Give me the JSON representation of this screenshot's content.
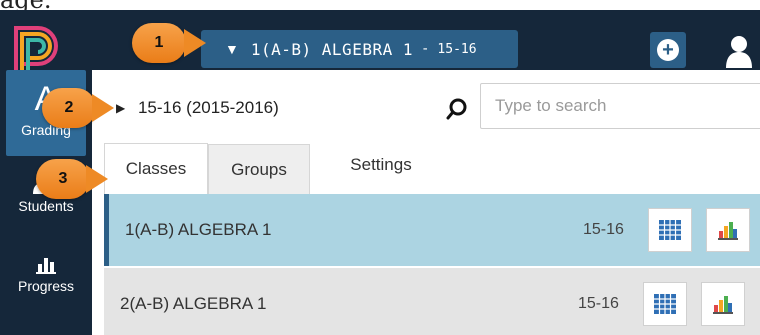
{
  "caption": "age.",
  "header": {
    "class_selector": {
      "name": "1(A-B) ALGEBRA 1",
      "separator": "-",
      "year": "15-16"
    }
  },
  "sidebar": {
    "items": [
      {
        "glyph": "A",
        "label": "Grading",
        "active": true
      },
      {
        "label": "Students",
        "icon": "students-icon"
      },
      {
        "label": "Progress",
        "icon": "bar-chart-icon"
      }
    ]
  },
  "year_toggle": {
    "label": "15-16 (2015-2016)"
  },
  "search": {
    "placeholder": "Type to search"
  },
  "tabs": [
    {
      "label": "Classes",
      "selected": true
    },
    {
      "label": "Groups"
    },
    {
      "label": "Settings"
    }
  ],
  "classes": [
    {
      "name": "1(A-B) ALGEBRA 1",
      "year": "15-16",
      "selected": true
    },
    {
      "name": "2(A-B) ALGEBRA 1",
      "year": "15-16"
    }
  ],
  "callouts": [
    {
      "number": "1"
    },
    {
      "number": "2"
    },
    {
      "number": "3"
    }
  ],
  "colors": {
    "topbar": "#15273a",
    "accent": "#2c5f87",
    "selected_row": "#acd4e2",
    "callout": "#ee8a25"
  }
}
